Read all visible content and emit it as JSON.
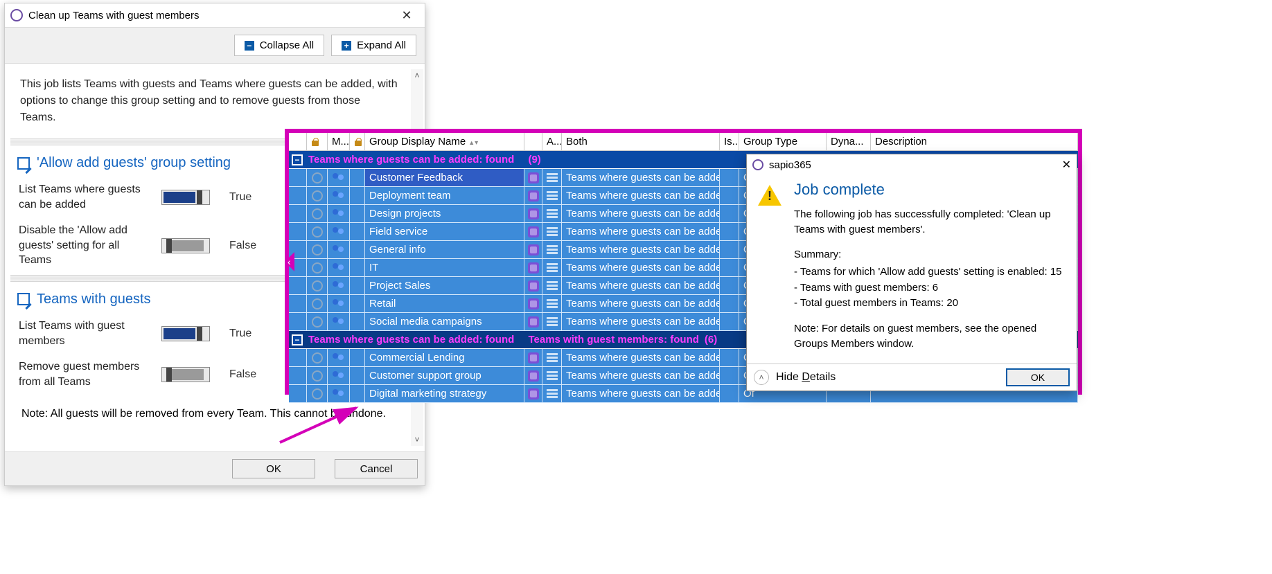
{
  "dlg1": {
    "title": "Clean up Teams with guest members",
    "collapse": "Collapse All",
    "expand": "Expand All",
    "desc": "This job lists Teams with guests and Teams where guests can be added, with options to change this group setting and to remove guests from those Teams.",
    "sec1": {
      "title": "'Allow add guests' group setting",
      "opt1": {
        "label": "List Teams where guests can be added",
        "state": "True"
      },
      "opt2": {
        "label": "Disable the 'Allow add guests' setting for all Teams",
        "state": "False"
      }
    },
    "sec2": {
      "title": "Teams with guests",
      "opt1": {
        "label": "List Teams with guest members",
        "state": "True"
      },
      "opt2": {
        "label": "Remove guest members from all Teams",
        "state": "False"
      }
    },
    "note": "Note: All guests will be removed from every Team. This cannot be undone.",
    "ok": "OK",
    "cancel": "Cancel"
  },
  "grid": {
    "cols": {
      "m": "M...",
      "name": "Group Display Name",
      "a": "A...",
      "both": "Both",
      "is": "Is...",
      "type": "Group Type",
      "dyn": "Dyna...",
      "desc": "Description"
    },
    "grp1": {
      "label": "Teams where guests can be added: found",
      "count": "(9)"
    },
    "grp2": {
      "label": "Teams where guests can be added: found",
      "label2": "Teams with guest members: found",
      "count": "(6)"
    },
    "bothText": "Teams where guests can be adde",
    "of": "Of",
    "rows1": [
      "Customer Feedback",
      "Deployment team",
      "Design projects",
      "Field service",
      "General info",
      "IT",
      "Project Sales",
      "Retail",
      "Social media campaigns"
    ],
    "rows2": [
      "Commercial Lending",
      "Customer support group",
      "Digital marketing strategy"
    ]
  },
  "dlg2": {
    "app": "sapio365",
    "h": "Job complete",
    "p1": "The following job has successfully completed: 'Clean up Teams with guest members'.",
    "summary": "Summary:",
    "items": [
      "Teams for which 'Allow add guests' setting is enabled: 15",
      "Teams with guest members: 6",
      "Total guest members in Teams: 20"
    ],
    "p2": "Note: For details on guest members, see the opened Groups Members window.",
    "hide": "Hide Details",
    "ok": "OK"
  }
}
